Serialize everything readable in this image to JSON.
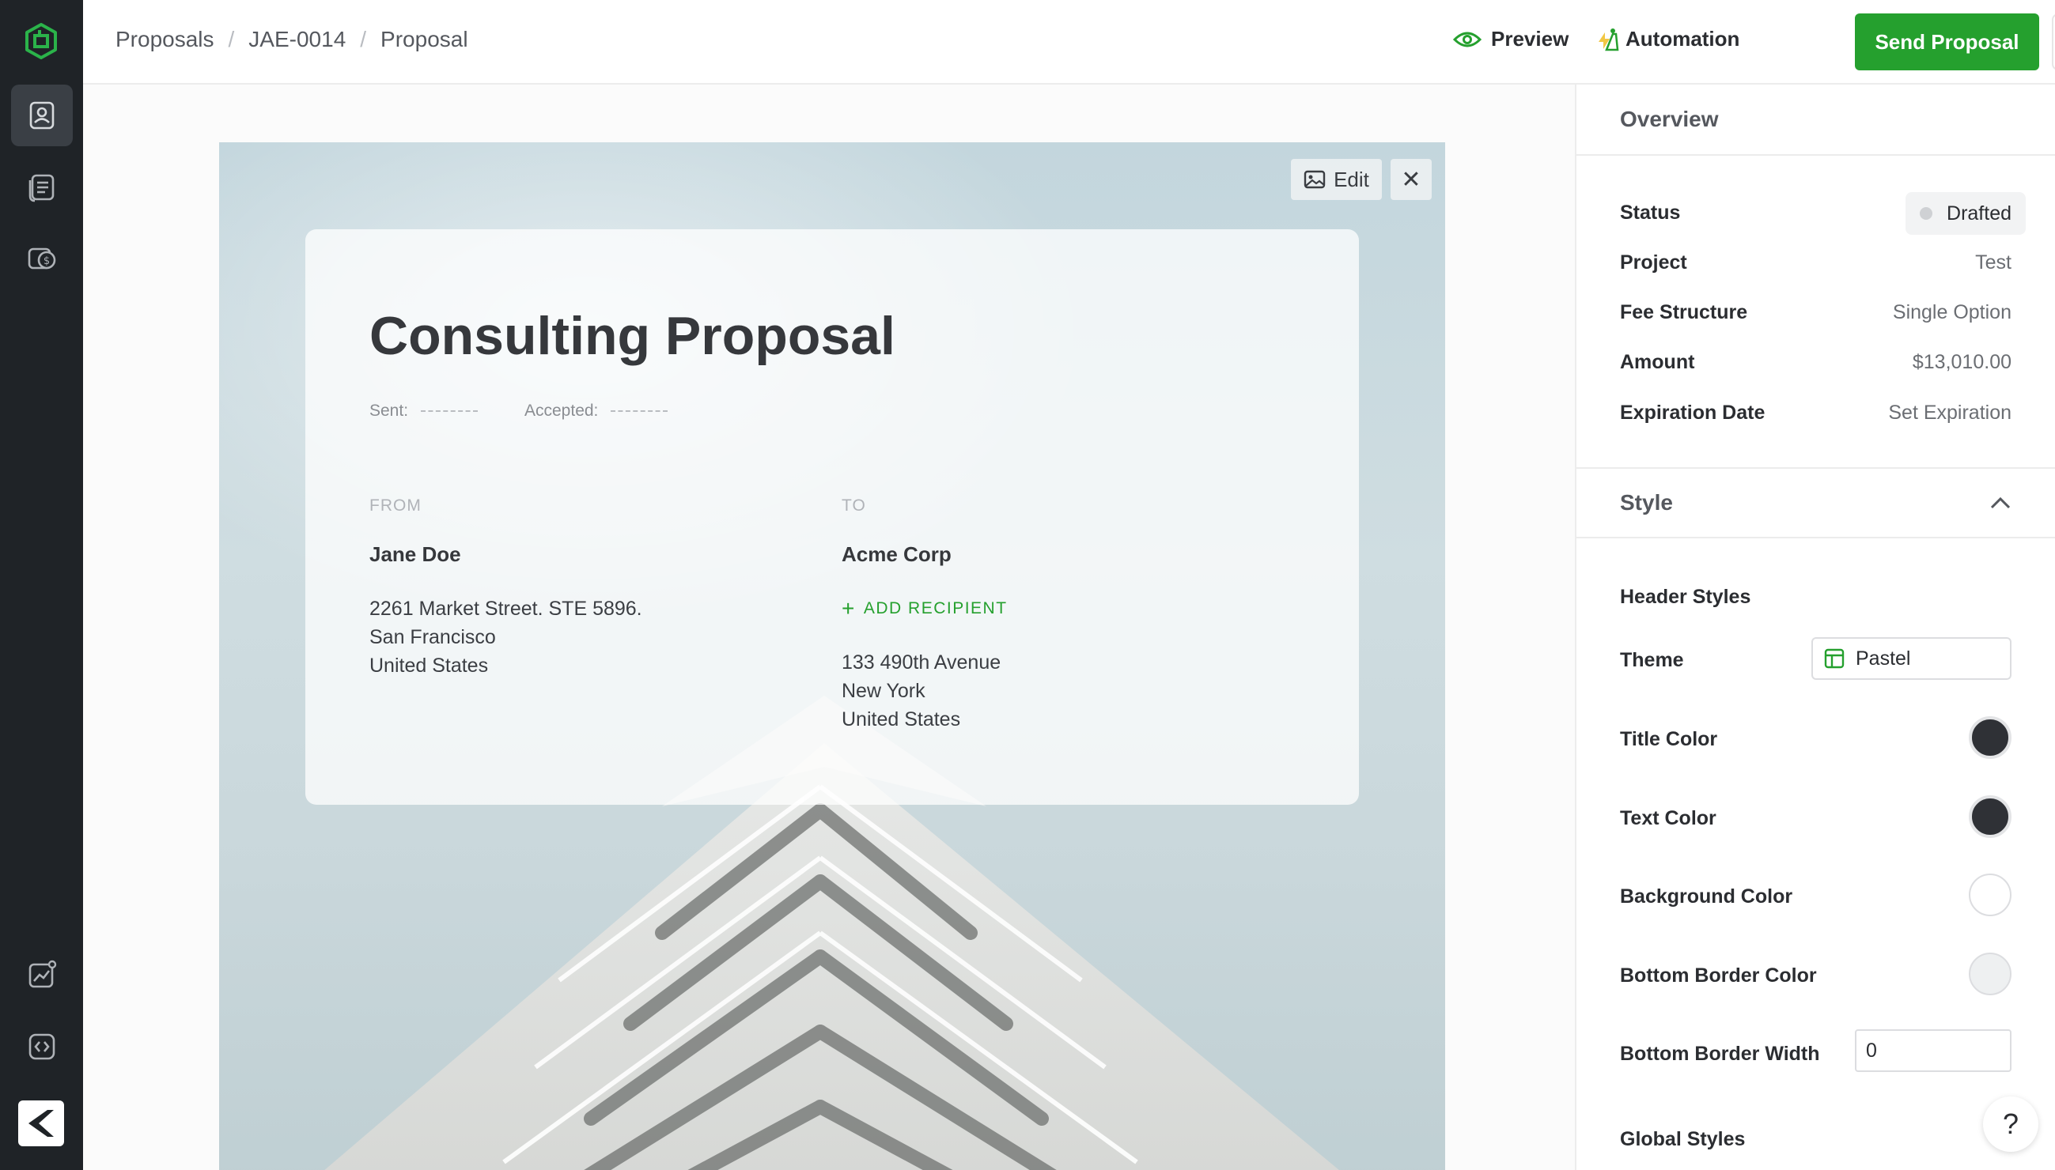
{
  "breadcrumb": [
    "Proposals",
    "JAE-0014",
    "Proposal"
  ],
  "toolbar": {
    "preview_label": "Preview",
    "automation_label": "Automation",
    "send_label": "Send Proposal",
    "more_label": "•••"
  },
  "document": {
    "edit_label": "Edit",
    "close_label": "✕",
    "title": "Consulting Proposal",
    "sent_label": "Sent:",
    "accepted_label": "Accepted:",
    "from": {
      "label": "FROM",
      "name": "Jane Doe",
      "address_line1": "2261 Market Street. STE 5896.",
      "address_line2": "San Francisco",
      "address_line3": "United States"
    },
    "to": {
      "label": "TO",
      "name": "Acme Corp",
      "add_recipient_label": "ADD RECIPIENT",
      "address_line1": "133 490th Avenue",
      "address_line2": "New York",
      "address_line3": "United States"
    }
  },
  "overview": {
    "heading": "Overview",
    "status_label": "Status",
    "status_value": "Drafted",
    "project_label": "Project",
    "project_value": "Test",
    "fee_label": "Fee Structure",
    "fee_value": "Single Option",
    "amount_label": "Amount",
    "amount_value": "$13,010.00",
    "expiration_label": "Expiration Date",
    "expiration_value": "Set Expiration"
  },
  "style": {
    "heading": "Style",
    "header_styles_label": "Header Styles",
    "theme_label": "Theme",
    "theme_value": "Pastel",
    "title_color_label": "Title Color",
    "title_color": "#2f3136",
    "text_color_label": "Text Color",
    "text_color": "#2f3136",
    "background_color_label": "Background Color",
    "background_color": "#ffffff",
    "bottom_border_color_label": "Bottom Border Color",
    "bottom_border_color": "#eef0f1",
    "bottom_border_width_label": "Bottom Border Width",
    "bottom_border_width_value": "0",
    "global_styles_label": "Global Styles"
  },
  "help_label": "?",
  "colors": {
    "accent": "#25a02e",
    "sidebar": "#1f2327"
  }
}
